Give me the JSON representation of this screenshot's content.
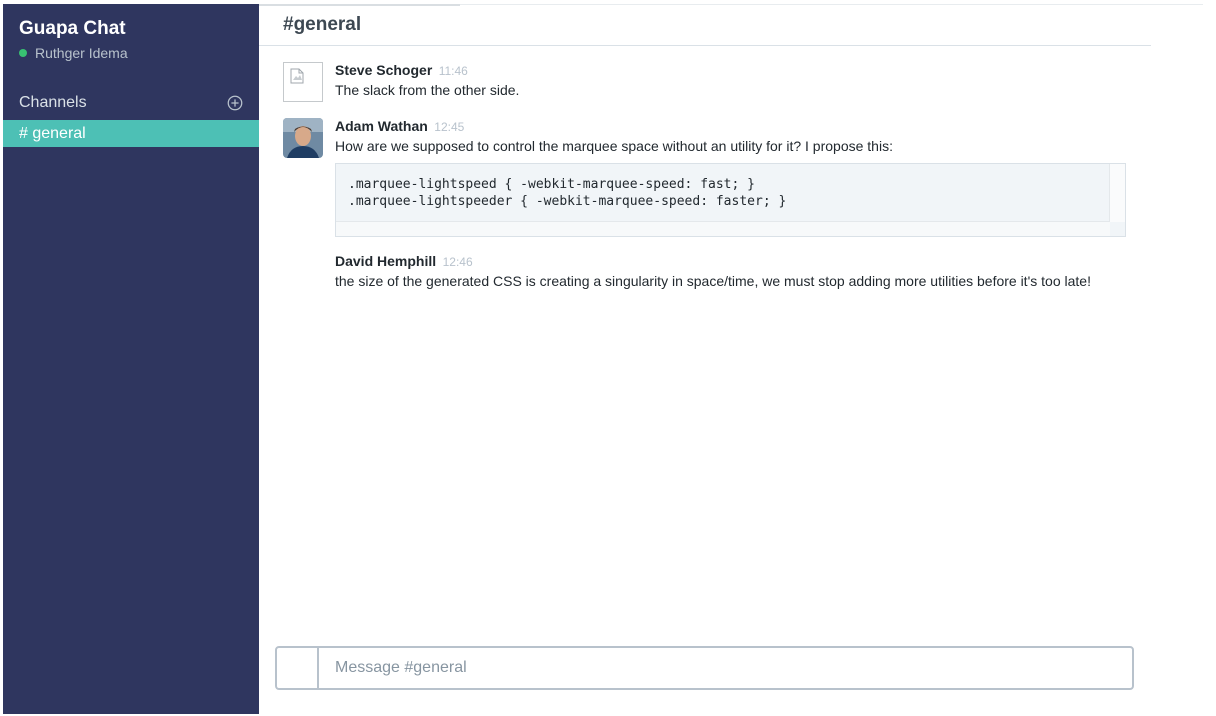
{
  "app": {
    "team_name": "Guapa Chat",
    "user_name": "Ruthger Idema",
    "presence_color": "#38c172"
  },
  "sidebar": {
    "channels_label": "Channels",
    "add_channel_icon": "plus-circle-icon",
    "channels": [
      {
        "label": "# general",
        "active": true
      }
    ]
  },
  "channel": {
    "title": "#general"
  },
  "messages": [
    {
      "author": "Steve Schoger",
      "time": "11:46",
      "text": "The slack from the other side.",
      "avatar": "broken-image"
    },
    {
      "author": "Adam Wathan",
      "time": "12:45",
      "text": "How are we supposed to control the marquee space without an utility for it? I propose this:",
      "avatar": "photo",
      "code": ".marquee-lightspeed { -webkit-marquee-speed: fast; }\n.marquee-lightspeeder { -webkit-marquee-speed: faster; }"
    },
    {
      "author": "David Hemphill",
      "time": "12:46",
      "text": "the size of the generated CSS is creating a singularity in space/time, we must stop adding more utilities before it's too late!",
      "avatar": null
    }
  ],
  "composer": {
    "placeholder": "Message #general",
    "value": ""
  }
}
